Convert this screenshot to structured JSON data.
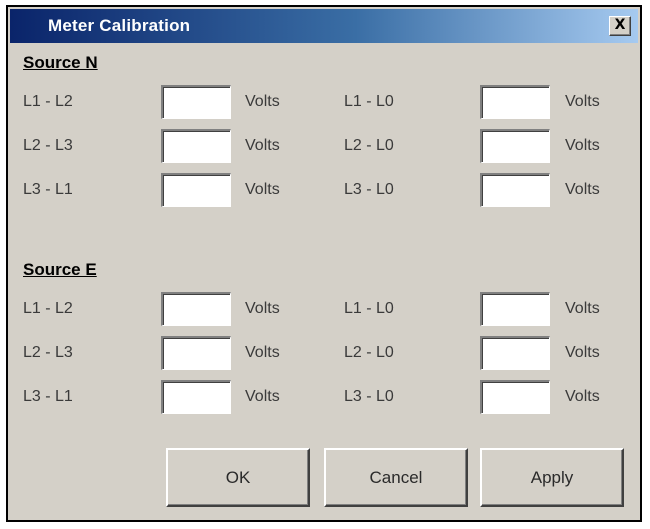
{
  "window": {
    "title": "Meter Calibration",
    "close_label": "X"
  },
  "source_n": {
    "heading": "Source N",
    "rows": [
      {
        "left_label": "L1 - L2",
        "left_value": "",
        "left_unit": "Volts",
        "right_label": "L1 - L0",
        "right_value": "",
        "right_unit": "Volts"
      },
      {
        "left_label": "L2 - L3",
        "left_value": "",
        "left_unit": "Volts",
        "right_label": "L2 - L0",
        "right_value": "",
        "right_unit": "Volts"
      },
      {
        "left_label": "L3 - L1",
        "left_value": "",
        "left_unit": "Volts",
        "right_label": "L3 - L0",
        "right_value": "",
        "right_unit": "Volts"
      }
    ]
  },
  "source_e": {
    "heading": "Source E",
    "rows": [
      {
        "left_label": "L1 - L2",
        "left_value": "",
        "left_unit": "Volts",
        "right_label": "L1 - L0",
        "right_value": "",
        "right_unit": "Volts"
      },
      {
        "left_label": "L2 - L3",
        "left_value": "",
        "left_unit": "Volts",
        "right_label": "L2 - L0",
        "right_value": "",
        "right_unit": "Volts"
      },
      {
        "left_label": "L3 - L1",
        "left_value": "",
        "left_unit": "Volts",
        "right_label": "L3 - L0",
        "right_value": "",
        "right_unit": "Volts"
      }
    ]
  },
  "buttons": {
    "ok": "OK",
    "cancel": "Cancel",
    "apply": "Apply"
  }
}
